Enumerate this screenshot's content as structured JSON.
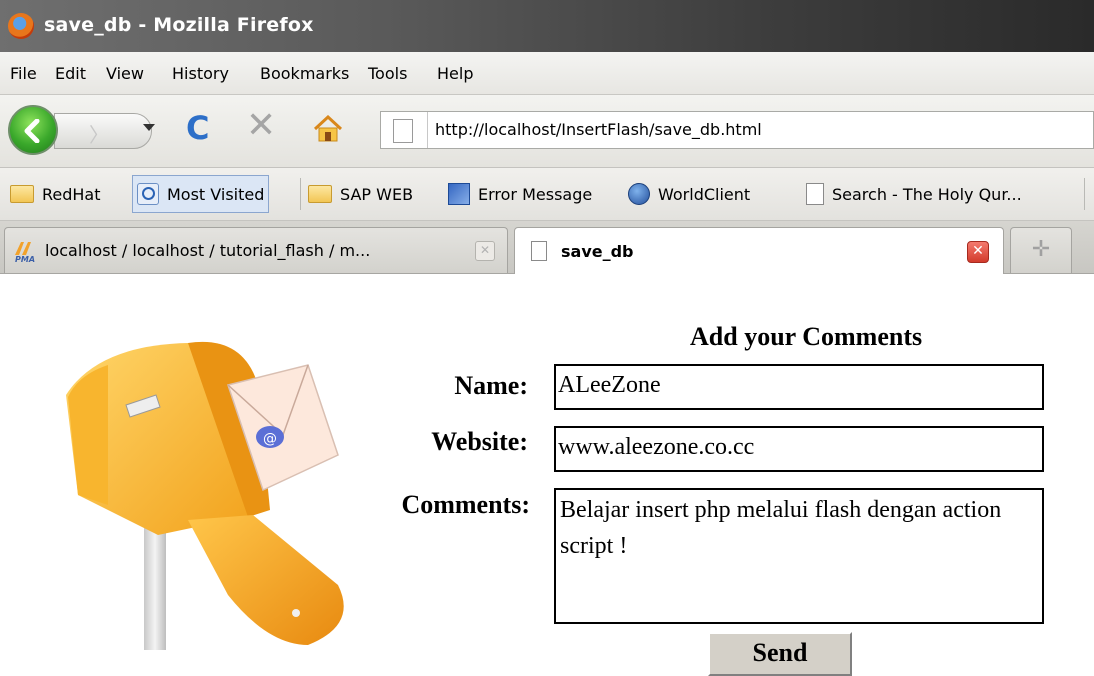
{
  "window": {
    "title": "save_db - Mozilla Firefox"
  },
  "menu": [
    "File",
    "Edit",
    "View",
    "History",
    "Bookmarks",
    "Tools",
    "Help"
  ],
  "address": {
    "url": "http://localhost/InsertFlash/save_db.html"
  },
  "bookmarks": [
    "RedHat",
    "Most Visited",
    "SAP WEB",
    "Error Message",
    "WorldClient",
    "Search - The Holy Qur..."
  ],
  "tabs": [
    {
      "label": "localhost / localhost / tutorial_flash / m...",
      "icon": "pma-icon"
    },
    {
      "label": "save_db",
      "icon": "page-icon"
    }
  ],
  "form": {
    "heading": "Add your Comments",
    "name_label": "Name:",
    "name_value": "ALeeZone",
    "website_label": "Website:",
    "website_value": "www.aleezone.co.cc",
    "comments_label": "Comments:",
    "comments_value": "Belajar insert php melalui flash dengan action script !",
    "send_label": "Send"
  }
}
